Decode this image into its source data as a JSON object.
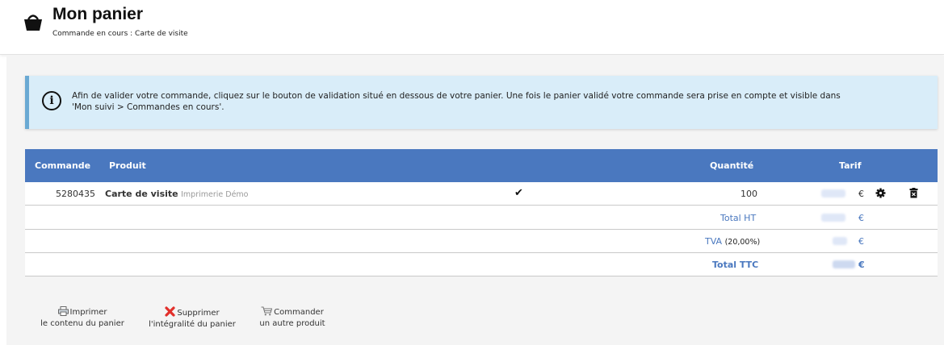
{
  "header": {
    "title": "Mon panier",
    "subtitle": "Commande en cours : Carte de visite",
    "icon": "basket-icon"
  },
  "info": {
    "icon": "info-circle-icon",
    "text_line1": "Afin de valider votre commande, cliquez sur le bouton de validation situé en dessous de votre panier. Une fois le panier validé votre commande sera prise en compte et visible dans",
    "text_line2": "'Mon suivi > Commandes en cours'."
  },
  "table": {
    "headers": {
      "commande": "Commande",
      "produit": "Produit",
      "quantite": "Quantité",
      "tarif": "Tarif"
    },
    "item": {
      "commande": "5280435",
      "produit": "Carte de visite",
      "fournisseur": "Imprimerie Démo",
      "quantite": "100",
      "currency": "€"
    },
    "totals": {
      "total_ht": "Total HT",
      "tva": "TVA",
      "tva_rate": "(20,00%)",
      "total_ttc": "Total TTC",
      "currency": "€"
    }
  },
  "actions": {
    "print_line1": "Imprimer",
    "print_line2": "le contenu du panier",
    "delete_line1": "Supprimer",
    "delete_line2": "l'intégralité du panier",
    "order_line1": "Commander",
    "order_line2": "un autre produit"
  },
  "colors": {
    "header_blue": "#4a78bf",
    "info_bg": "#d9edf9",
    "info_border": "#6aa9d3",
    "delete_red": "#e2302b"
  }
}
